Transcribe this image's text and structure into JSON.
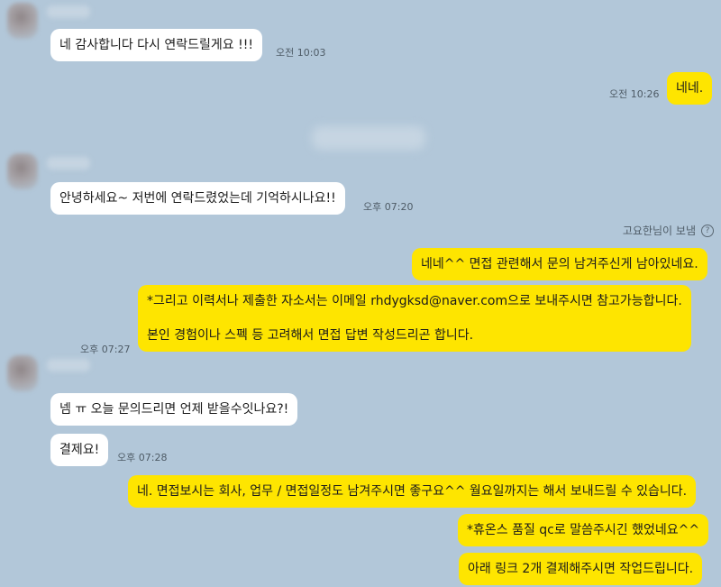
{
  "messages": [
    {
      "text": "네 감사합니다 다시 연락드릴게요 !!!",
      "time": "오전 10:03"
    },
    {
      "text": "네네.",
      "time": "오전 10:26"
    },
    {
      "text": "안녕하세요~ 저번에 연락드렸었는데 기억하시나요!!",
      "time": "오후 07:20"
    },
    {
      "text": "네네^^ 면접 관련해서 문의 남겨주신게 남아있네요."
    },
    {
      "paragraphs": [
        "*그리고 이력서나 제출한 자소서는 이메일 rhdygksd@naver.com으로 보내주시면 참고가능합니다.",
        "본인 경험이나 스펙 등 고려해서 면접 답변 작성드리곤 합니다."
      ],
      "time": "오후 07:27"
    },
    {
      "text": "넴 ㅠ 오늘 문의드리면 언제 받을수잇나요?!"
    },
    {
      "text": "결제요!",
      "time": "오후 07:28"
    },
    {
      "text": "네. 면접보시는 회사, 업무 / 면접일정도 남겨주시면 좋구요^^ 월요일까지는 해서 보내드릴 수 있습니다."
    },
    {
      "text": "*휴온스 품질 qc로 말씀주시긴 했었네요^^"
    },
    {
      "text": "아래 링크 2개 결제해주시면 작업드립니다."
    }
  ],
  "sender_note": {
    "text": "고요한님이 보냄",
    "icon": "help-circle-icon"
  },
  "colors": {
    "background": "#b2c7d9",
    "incoming": "#ffffff",
    "outgoing": "#fee500"
  }
}
